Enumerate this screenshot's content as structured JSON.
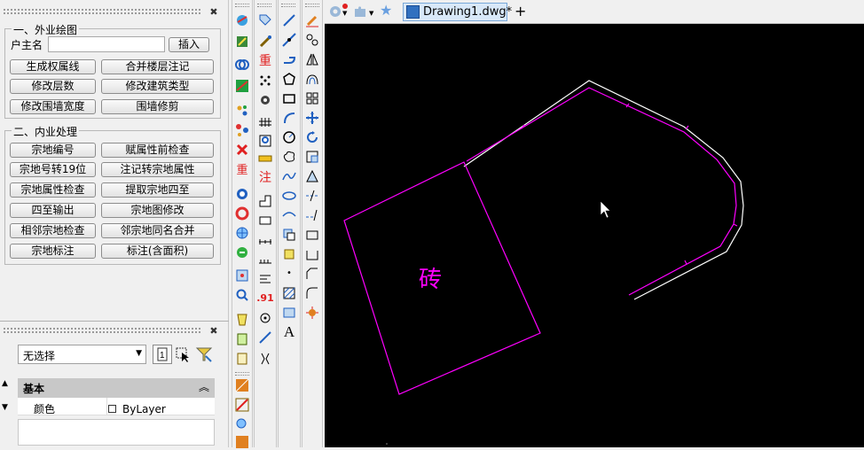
{
  "left_panel": {
    "close_icon": "close-icon",
    "section1": {
      "title": "一、外业绘图",
      "owner_label": "户主名",
      "owner_value": "",
      "insert_button": "插入",
      "buttons": [
        "生成权属线",
        "合并楼层注记",
        "修改层数",
        "修改建筑类型",
        "修改围墙宽度",
        "围墙修剪"
      ]
    },
    "section2": {
      "title": "二、内业处理",
      "buttons": [
        "宗地编号",
        "赋属性前检查",
        "宗地号转19位",
        "注记转宗地属性",
        "宗地属性检查",
        "提取宗地四至",
        "四至输出",
        "宗地图修改",
        "相邻宗地检查",
        "邻宗地同名合并",
        "宗地标注",
        "标注(含面积)"
      ]
    }
  },
  "properties_panel": {
    "selection": "无选择",
    "category_header": "基本",
    "rows": [
      {
        "label": "颜色",
        "value": "ByLayer"
      }
    ]
  },
  "toolbars": {
    "col1_text_icons": [
      "重",
      "注"
    ],
    "col2_text_icons": [
      ".91"
    ],
    "col3_text_icons": [
      "A"
    ]
  },
  "tabbar": {
    "doc_tab": "Drawing1.dwg*",
    "new_tab": "+"
  },
  "drawing": {
    "text_label": "砖",
    "colors": {
      "parcel": "#ff00ff",
      "outline": "#ffffff",
      "background": "#000000"
    }
  }
}
